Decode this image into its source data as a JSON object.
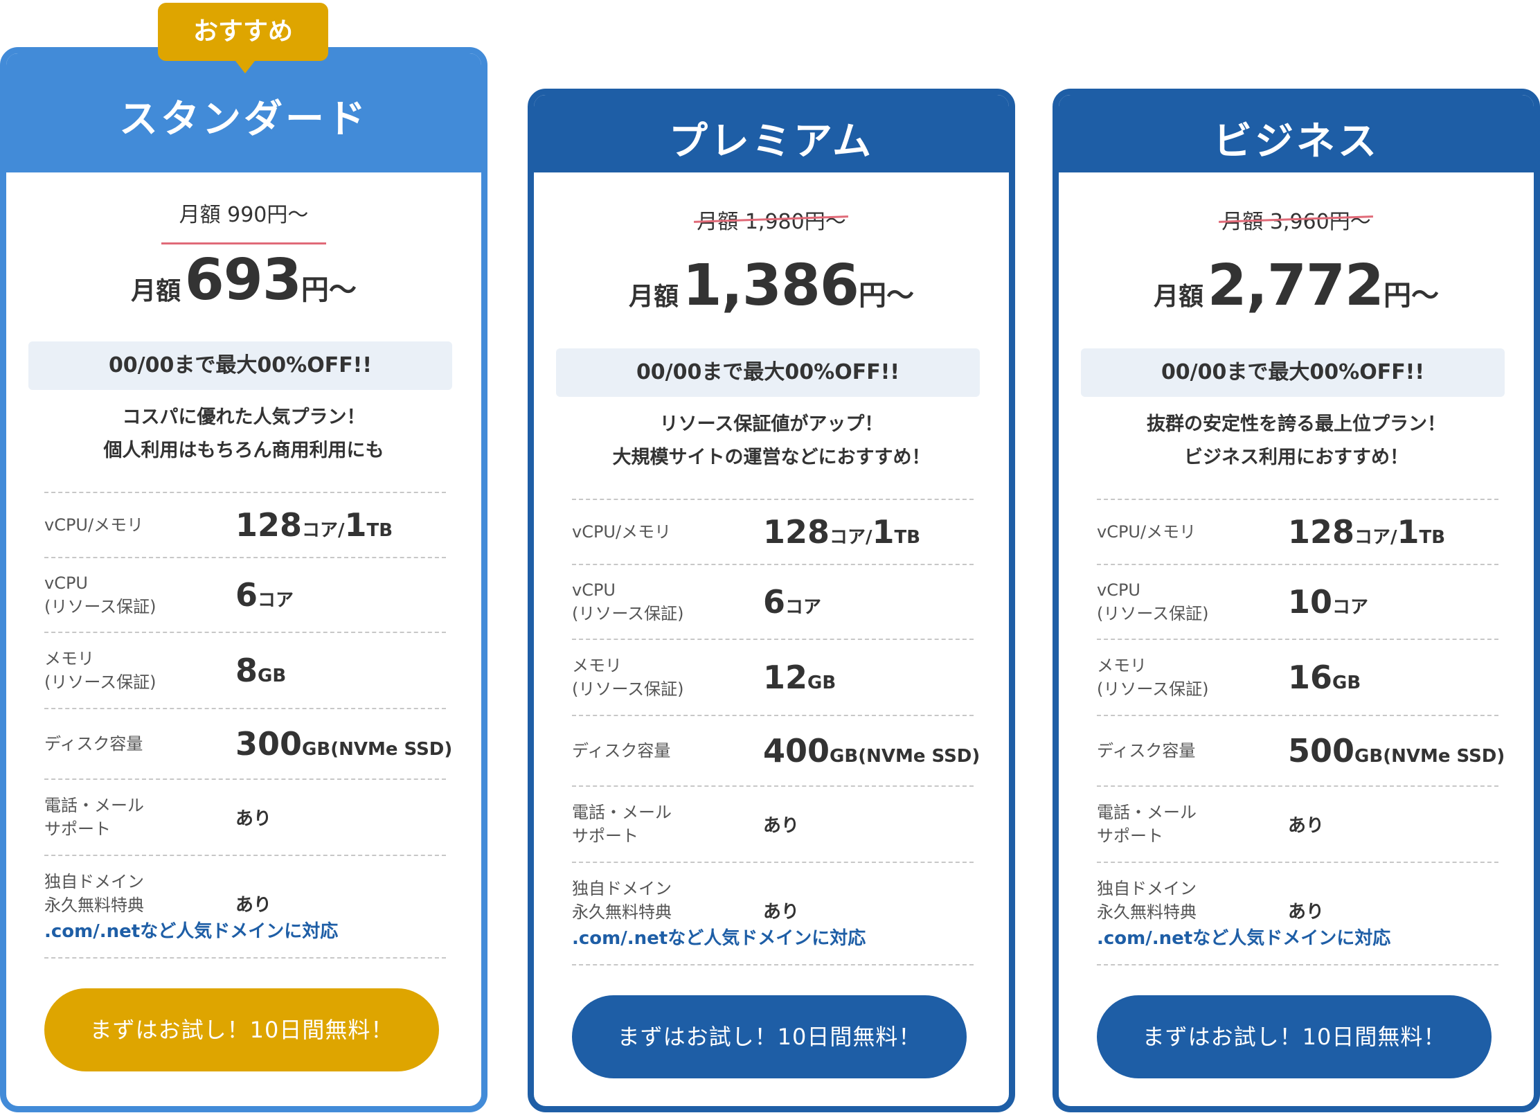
{
  "colors": {
    "primary_light": "#428bd8",
    "primary_dark": "#1e5ea6",
    "accent": "#dea500",
    "strike": "#e06a78",
    "promo_bg": "#eaf0f7"
  },
  "recommended_badge": "おすすめ",
  "spec_labels": {
    "cpu_memory": "vCPU/メモリ",
    "vcpu_line1": "vCPU",
    "vcpu_line2": "(リソース保証)",
    "memory_line1": "メモリ",
    "memory_line2": "(リソース保証)",
    "disk": "ディスク容量",
    "support_line1": "電話・メール",
    "support_line2": "サポート",
    "domain_line1": "独自ドメイン",
    "domain_line2": "永久無料特典"
  },
  "plans": [
    {
      "name": "スタンダード",
      "original_price": "月額 990円〜",
      "price_prefix": "月額",
      "price": "693",
      "price_suffix": "円〜",
      "promo": "00/00まで最大00%OFF!!",
      "desc_line1": "コスパに優れた人気プラン！",
      "desc_line2": "個人利用はもちろん商用利用にも",
      "cpu_mem": {
        "cores": "128",
        "cores_unit": "コア/",
        "mem": "1",
        "mem_unit": "TB"
      },
      "vcpu": {
        "value": "6",
        "unit": "コア"
      },
      "memory": {
        "value": "8",
        "unit": "GB"
      },
      "disk": {
        "value": "300",
        "unit": "GB(NVMe SSD)"
      },
      "support": "あり",
      "domain": "あり",
      "domain_note": ".com/.netなど人気ドメインに対応",
      "cta": "まずはお試し！10日間無料！"
    },
    {
      "name": "プレミアム",
      "original_price": "月額 1,980円〜",
      "price_prefix": "月額",
      "price": "1,386",
      "price_suffix": "円〜",
      "promo": "00/00まで最大00%OFF!!",
      "desc_line1": "リソース保証値がアップ！",
      "desc_line2": "大規模サイトの運営などにおすすめ！",
      "cpu_mem": {
        "cores": "128",
        "cores_unit": "コア/",
        "mem": "1",
        "mem_unit": "TB"
      },
      "vcpu": {
        "value": "6",
        "unit": "コア"
      },
      "memory": {
        "value": "12",
        "unit": "GB"
      },
      "disk": {
        "value": "400",
        "unit": "GB(NVMe SSD)"
      },
      "support": "あり",
      "domain": "あり",
      "domain_note": ".com/.netなど人気ドメインに対応",
      "cta": "まずはお試し！10日間無料！"
    },
    {
      "name": "ビジネス",
      "original_price": "月額 3,960円〜",
      "price_prefix": "月額",
      "price": "2,772",
      "price_suffix": "円〜",
      "promo": "00/00まで最大00%OFF!!",
      "desc_line1": "抜群の安定性を誇る最上位プラン！",
      "desc_line2": "ビジネス利用におすすめ！",
      "cpu_mem": {
        "cores": "128",
        "cores_unit": "コア/",
        "mem": "1",
        "mem_unit": "TB"
      },
      "vcpu": {
        "value": "10",
        "unit": "コア"
      },
      "memory": {
        "value": "16",
        "unit": "GB"
      },
      "disk": {
        "value": "500",
        "unit": "GB(NVMe SSD)"
      },
      "support": "あり",
      "domain": "あり",
      "domain_note": ".com/.netなど人気ドメインに対応",
      "cta": "まずはお試し！10日間無料！"
    }
  ]
}
